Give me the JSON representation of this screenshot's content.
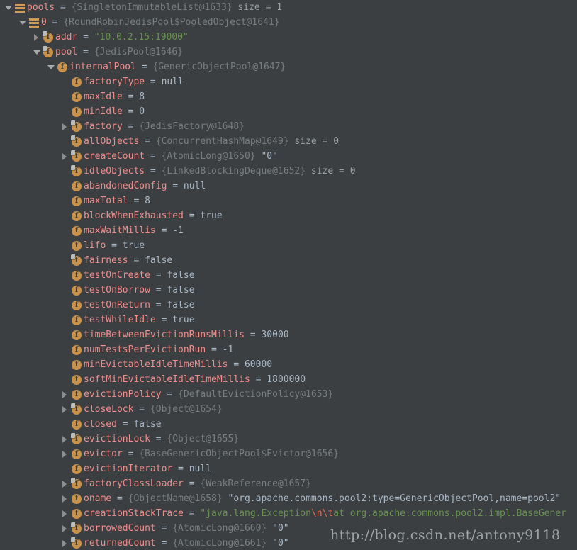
{
  "panel": {
    "name": "debugger-variables-tree",
    "background": "#3c3f41",
    "colors": {
      "field_name": "#f08d8d",
      "type_ref": "#787d80",
      "string_value": "#6a9153",
      "escape_seq": "#e06c5e",
      "plain_value": "#a9b7c6",
      "icon_orange": "#c9924a"
    }
  },
  "watermark": {
    "text": "http://blog.csdn.net/antony9118"
  },
  "rows": [
    {
      "depth": 0,
      "toggle": "expanded",
      "icon": "list-icon",
      "name": "pools",
      "eq": "=",
      "type": "{SingletonImmutableList@1633}",
      "meta": "size = 1"
    },
    {
      "depth": 1,
      "toggle": "expanded",
      "icon": "list-icon",
      "name": "0",
      "eq": "=",
      "type": "{RoundRobinJedisPool$PooledObject@1641}"
    },
    {
      "depth": 2,
      "toggle": "collapsed",
      "icon": "field-final-icon",
      "name": "addr",
      "eq": "=",
      "string": "\"10.0.2.15:19000\""
    },
    {
      "depth": 2,
      "toggle": "expanded",
      "icon": "field-final-icon",
      "name": "pool",
      "eq": "=",
      "type": "{JedisPool@1646}"
    },
    {
      "depth": 3,
      "toggle": "expanded",
      "icon": "field-icon",
      "name": "internalPool",
      "eq": "=",
      "type": "{GenericObjectPool@1647}"
    },
    {
      "depth": 4,
      "toggle": "none",
      "icon": "field-icon",
      "name": "factoryType",
      "eq": "=",
      "value": "null"
    },
    {
      "depth": 4,
      "toggle": "none",
      "icon": "field-icon",
      "name": "maxIdle",
      "eq": "=",
      "value": "8"
    },
    {
      "depth": 4,
      "toggle": "none",
      "icon": "field-icon",
      "name": "minIdle",
      "eq": "=",
      "value": "0"
    },
    {
      "depth": 4,
      "toggle": "collapsed",
      "icon": "field-final-icon",
      "name": "factory",
      "eq": "=",
      "type": "{JedisFactory@1648}"
    },
    {
      "depth": 4,
      "toggle": "none",
      "icon": "field-final-icon",
      "name": "allObjects",
      "eq": "=",
      "type": "{ConcurrentHashMap@1649}",
      "meta": "size = 0"
    },
    {
      "depth": 4,
      "toggle": "collapsed",
      "icon": "field-final-icon",
      "name": "createCount",
      "eq": "=",
      "type": "{AtomicLong@1650}",
      "value": "\"0\""
    },
    {
      "depth": 4,
      "toggle": "none",
      "icon": "field-final-icon",
      "name": "idleObjects",
      "eq": "=",
      "type": "{LinkedBlockingDeque@1652}",
      "meta": "size = 0"
    },
    {
      "depth": 4,
      "toggle": "none",
      "icon": "field-icon",
      "name": "abandonedConfig",
      "eq": "=",
      "value": "null"
    },
    {
      "depth": 4,
      "toggle": "none",
      "icon": "field-icon",
      "name": "maxTotal",
      "eq": "=",
      "value": "8"
    },
    {
      "depth": 4,
      "toggle": "none",
      "icon": "field-icon",
      "name": "blockWhenExhausted",
      "eq": "=",
      "value": "true"
    },
    {
      "depth": 4,
      "toggle": "none",
      "icon": "field-icon",
      "name": "maxWaitMillis",
      "eq": "=",
      "value": "-1"
    },
    {
      "depth": 4,
      "toggle": "none",
      "icon": "field-icon",
      "name": "lifo",
      "eq": "=",
      "value": "true"
    },
    {
      "depth": 4,
      "toggle": "none",
      "icon": "field-final-icon",
      "name": "fairness",
      "eq": "=",
      "value": "false"
    },
    {
      "depth": 4,
      "toggle": "none",
      "icon": "field-icon",
      "name": "testOnCreate",
      "eq": "=",
      "value": "false"
    },
    {
      "depth": 4,
      "toggle": "none",
      "icon": "field-icon",
      "name": "testOnBorrow",
      "eq": "=",
      "value": "false"
    },
    {
      "depth": 4,
      "toggle": "none",
      "icon": "field-icon",
      "name": "testOnReturn",
      "eq": "=",
      "value": "false"
    },
    {
      "depth": 4,
      "toggle": "none",
      "icon": "field-icon",
      "name": "testWhileIdle",
      "eq": "=",
      "value": "true"
    },
    {
      "depth": 4,
      "toggle": "none",
      "icon": "field-icon",
      "name": "timeBetweenEvictionRunsMillis",
      "eq": "=",
      "value": "30000"
    },
    {
      "depth": 4,
      "toggle": "none",
      "icon": "field-icon",
      "name": "numTestsPerEvictionRun",
      "eq": "=",
      "value": "-1"
    },
    {
      "depth": 4,
      "toggle": "none",
      "icon": "field-icon",
      "name": "minEvictableIdleTimeMillis",
      "eq": "=",
      "value": "60000"
    },
    {
      "depth": 4,
      "toggle": "none",
      "icon": "field-icon",
      "name": "softMinEvictableIdleTimeMillis",
      "eq": "=",
      "value": "1800000"
    },
    {
      "depth": 4,
      "toggle": "collapsed",
      "icon": "field-icon",
      "name": "evictionPolicy",
      "eq": "=",
      "type": "{DefaultEvictionPolicy@1653}"
    },
    {
      "depth": 4,
      "toggle": "collapsed",
      "icon": "field-final-icon",
      "name": "closeLock",
      "eq": "=",
      "type": "{Object@1654}"
    },
    {
      "depth": 4,
      "toggle": "none",
      "icon": "field-icon",
      "name": "closed",
      "eq": "=",
      "value": "false"
    },
    {
      "depth": 4,
      "toggle": "collapsed",
      "icon": "field-final-icon",
      "name": "evictionLock",
      "eq": "=",
      "type": "{Object@1655}"
    },
    {
      "depth": 4,
      "toggle": "collapsed",
      "icon": "field-icon",
      "name": "evictor",
      "eq": "=",
      "type": "{BaseGenericObjectPool$Evictor@1656}"
    },
    {
      "depth": 4,
      "toggle": "none",
      "icon": "field-icon",
      "name": "evictionIterator",
      "eq": "=",
      "value": "null"
    },
    {
      "depth": 4,
      "toggle": "collapsed",
      "icon": "field-final-icon",
      "name": "factoryClassLoader",
      "eq": "=",
      "type": "{WeakReference@1657}"
    },
    {
      "depth": 4,
      "toggle": "collapsed",
      "icon": "field-icon",
      "name": "oname",
      "eq": "=",
      "type": "{ObjectName@1658}",
      "value": "\"org.apache.commons.pool2:type=GenericObjectPool,name=pool2\""
    },
    {
      "depth": 4,
      "toggle": "collapsed",
      "icon": "field-icon",
      "name": "creationStackTrace",
      "eq": "=",
      "string_parts": [
        {
          "t": "str",
          "v": "\"java.lang.Exception"
        },
        {
          "t": "esc",
          "v": "\\n\\t"
        },
        {
          "t": "str",
          "v": "at org.apache.commons.pool2.impl.BaseGener"
        }
      ]
    },
    {
      "depth": 4,
      "toggle": "collapsed",
      "icon": "field-final-icon",
      "name": "borrowedCount",
      "eq": "=",
      "type": "{AtomicLong@1660}",
      "value": "\"0\""
    },
    {
      "depth": 4,
      "toggle": "collapsed",
      "icon": "field-final-icon",
      "name": "returnedCount",
      "eq": "=",
      "type": "{AtomicLong@1661}",
      "value": "\"0\""
    }
  ]
}
